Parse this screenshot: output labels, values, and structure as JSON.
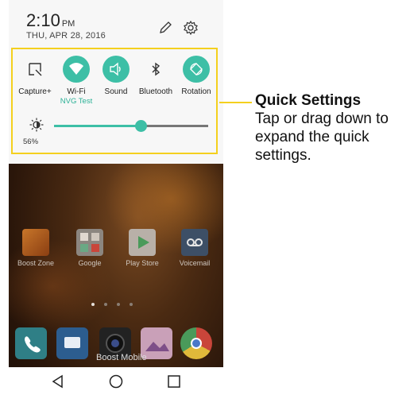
{
  "status": {
    "time": "2:10",
    "ampm": "PM",
    "date": "THU, APR 28, 2016"
  },
  "quick_settings": {
    "tiles": [
      {
        "label": "Capture+",
        "sub": "",
        "active": false,
        "icon": "capture-plus-icon"
      },
      {
        "label": "Wi-Fi",
        "sub": "NVG Test",
        "active": true,
        "icon": "wifi-icon"
      },
      {
        "label": "Sound",
        "sub": "",
        "active": true,
        "icon": "sound-icon"
      },
      {
        "label": "Bluetooth",
        "sub": "",
        "active": false,
        "icon": "bluetooth-icon"
      },
      {
        "label": "Rotation",
        "sub": "",
        "active": true,
        "icon": "rotation-icon"
      }
    ],
    "brightness_percent": "56%",
    "brightness_level": 0.56
  },
  "home_apps": [
    {
      "name": "Boost Zone",
      "icon": "boost-zone-icon"
    },
    {
      "name": "Google",
      "icon": "google-folder-icon"
    },
    {
      "name": "Play Store",
      "icon": "play-store-icon"
    },
    {
      "name": "Voicemail",
      "icon": "voicemail-icon"
    }
  ],
  "carrier": "Boost Mobile",
  "callout": {
    "title": "Quick Settings",
    "body": "Tap or drag down to expand the quick settings."
  },
  "colors": {
    "accent": "#3dbfa6",
    "highlight": "#f4d01e"
  }
}
